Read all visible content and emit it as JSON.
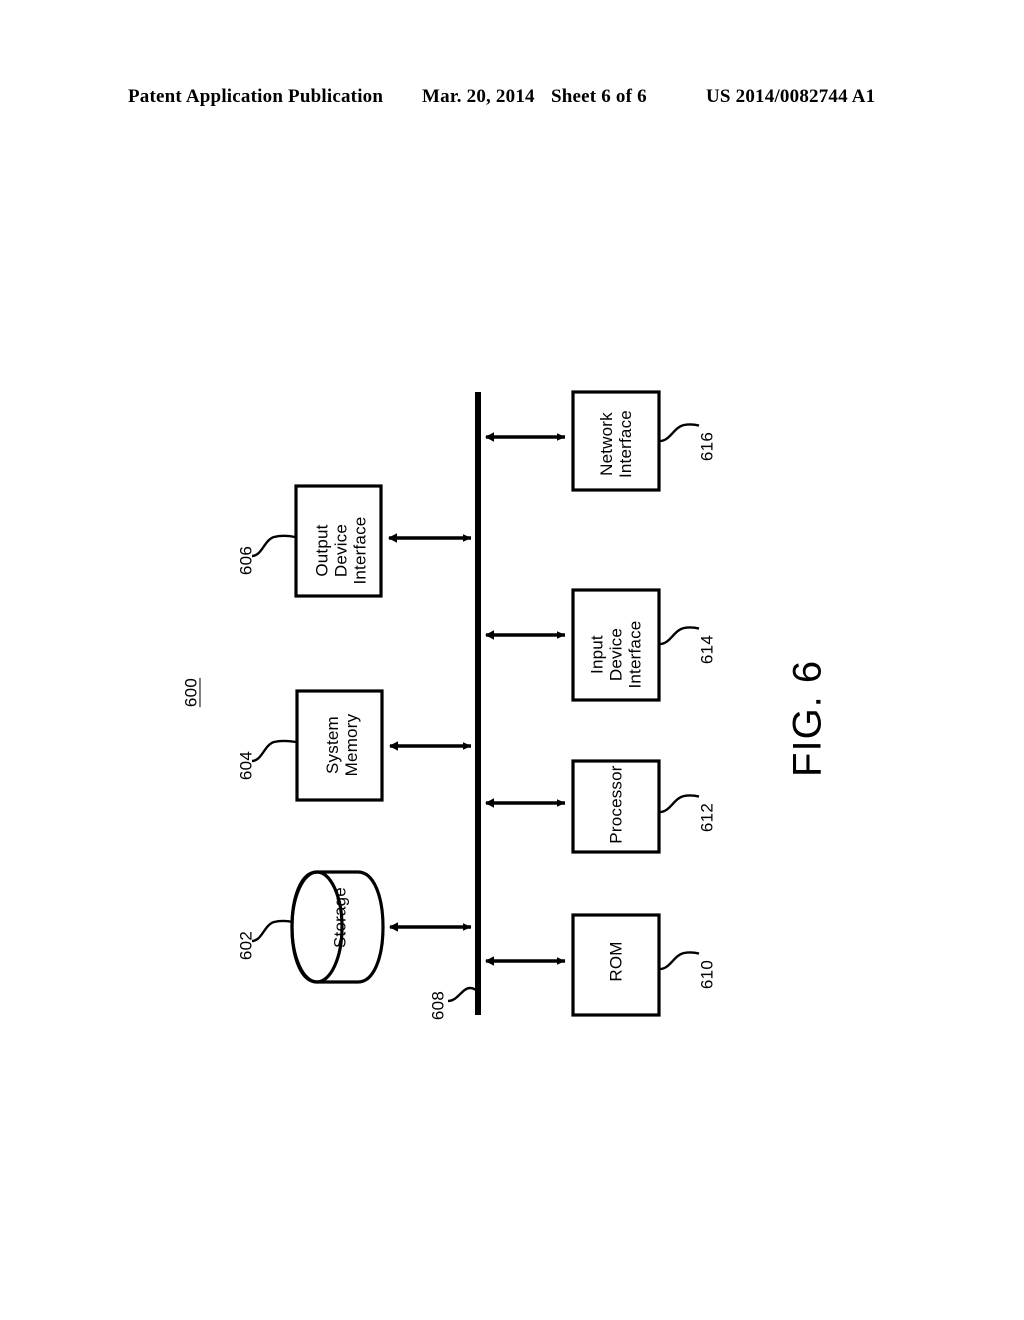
{
  "header": {
    "publication": "Patent Application Publication",
    "date": "Mar. 20, 2014",
    "sheet": "Sheet 6 of 6",
    "document_number": "US 2014/0082744 A1"
  },
  "figure": {
    "caption": "FIG. 6",
    "system_ref": "600",
    "bus": {
      "label": "608",
      "name": "system-bus"
    },
    "nodes": [
      {
        "id": "storage",
        "label": "Storage",
        "ref": "602",
        "shape": "cylinder",
        "side": "left"
      },
      {
        "id": "system-memory",
        "label": "System\nMemory",
        "line1": "System",
        "line2": "Memory",
        "ref": "604",
        "shape": "rect",
        "side": "left"
      },
      {
        "id": "output-device-interface",
        "label": "Output Device Interface",
        "line1": "Output",
        "line2": "Device",
        "line3": "Interface",
        "ref": "606",
        "shape": "rect",
        "side": "left"
      },
      {
        "id": "rom",
        "label": "ROM",
        "ref": "610",
        "shape": "rect",
        "side": "right"
      },
      {
        "id": "processor",
        "label": "Processor",
        "ref": "612",
        "shape": "rect",
        "side": "right"
      },
      {
        "id": "input-device-interface",
        "label": "Input Device Interface",
        "line1": "Input",
        "line2": "Device",
        "line3": "Interface",
        "ref": "614",
        "shape": "rect",
        "side": "right"
      },
      {
        "id": "network-interface",
        "label": "Network Interface",
        "line1": "Network",
        "line2": "Interface",
        "ref": "616",
        "shape": "rect",
        "side": "right"
      }
    ],
    "colors": {
      "ink": "#000000",
      "paper": "#ffffff"
    }
  }
}
